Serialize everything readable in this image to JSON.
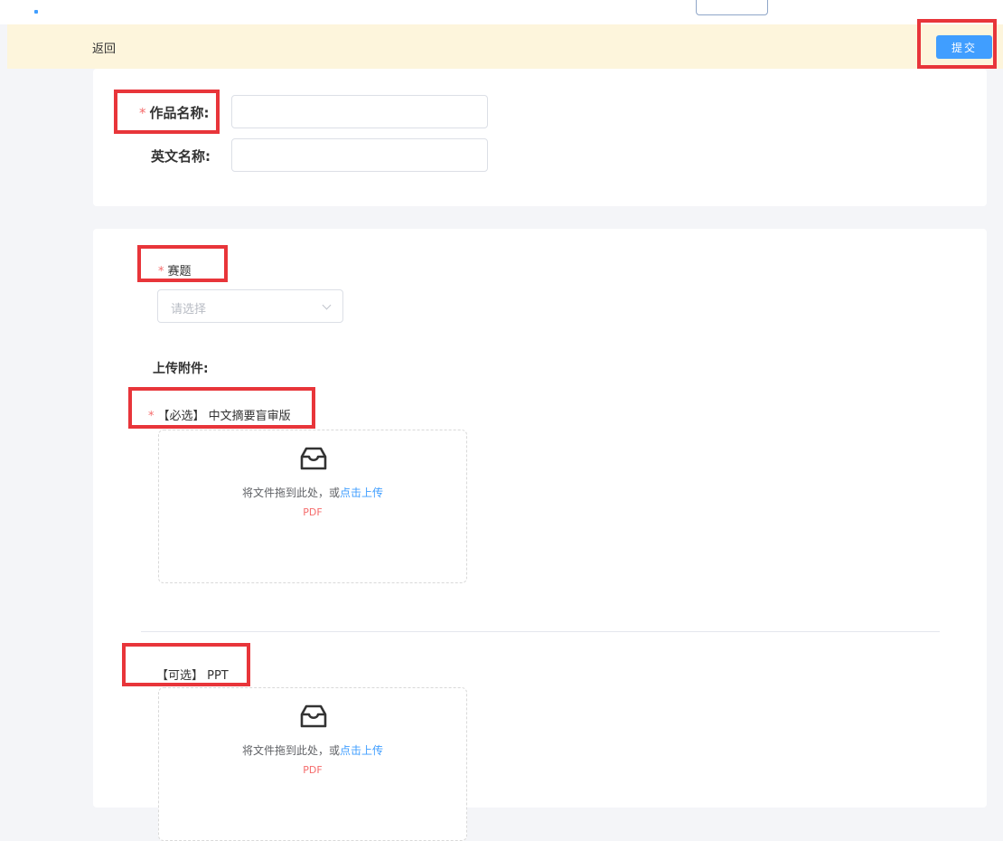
{
  "header": {
    "back_label": "返回",
    "submit_label": "提交"
  },
  "basic_info": {
    "work_name": {
      "required_mark": "*",
      "label": "作品名称:",
      "value": "",
      "placeholder": ""
    },
    "english_name": {
      "label": "英文名称:",
      "value": "",
      "placeholder": ""
    }
  },
  "topic": {
    "required_mark": "*",
    "label": "赛题",
    "select_placeholder": "请选择"
  },
  "attachments": {
    "section_title": "上传附件:",
    "items": [
      {
        "required_mark": "*",
        "label": "【必选】 中文摘要盲审版",
        "dropzone_text": "将文件拖到此处，或",
        "dropzone_link": "点击上传",
        "format": "PDF"
      },
      {
        "label": "【可选】 PPT",
        "dropzone_text": "将文件拖到此处，或",
        "dropzone_link": "点击上传",
        "format": "PDF"
      }
    ]
  },
  "colors": {
    "primary": "#409eff",
    "required": "#f56c6c",
    "header_bg": "#fdf5dc",
    "highlight": "#e8353a"
  }
}
